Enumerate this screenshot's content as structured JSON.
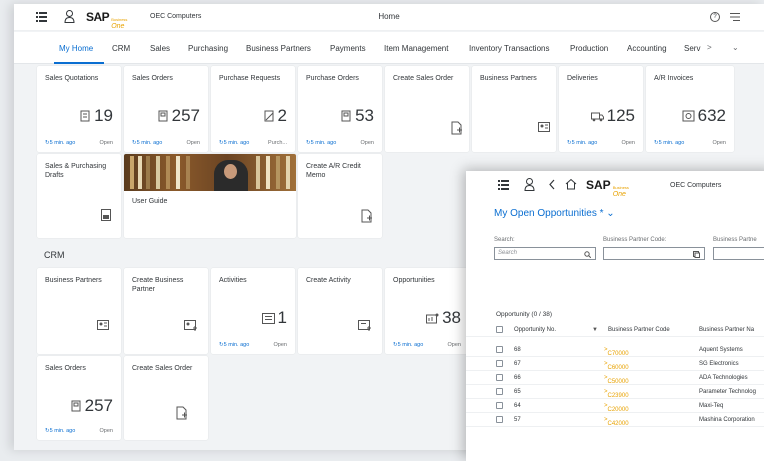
{
  "shell": {
    "brand": "SAP",
    "brand_sub_top": "Business",
    "brand_sub": "One",
    "company": "OEC Computers",
    "title": "Home",
    "help_icon": "help-icon",
    "more_icon": "overflow-icon"
  },
  "tabs": {
    "items": [
      "My Home",
      "CRM",
      "Sales",
      "Purchasing",
      "Business Partners",
      "Payments",
      "Item Management",
      "Inventory Transactions",
      "Production",
      "Accounting",
      "Serv"
    ],
    "active": "My Home"
  },
  "tiles_row1": [
    {
      "title": "Sales Quotations",
      "value": "19",
      "icon": "document-icon",
      "foot_l": "5 min. ago",
      "foot_r": "Open"
    },
    {
      "title": "Sales Orders",
      "value": "257",
      "icon": "sales-order-icon",
      "foot_l": "5 min. ago",
      "foot_r": "Open"
    },
    {
      "title": "Purchase Requests",
      "value": "2",
      "icon": "request-icon",
      "foot_l": "5 min. ago",
      "foot_r": "Purch..."
    },
    {
      "title": "Purchase Orders",
      "value": "53",
      "icon": "purchase-order-icon",
      "foot_l": "5 min. ago",
      "foot_r": "Open"
    },
    {
      "title": "Create Sales Order",
      "value": "",
      "icon": "add-document-icon",
      "foot_l": "",
      "foot_r": ""
    },
    {
      "title": "Business Partners",
      "value": "",
      "icon": "business-card-icon",
      "foot_l": "",
      "foot_r": ""
    },
    {
      "title": "Deliveries",
      "value": "125",
      "icon": "truck-icon",
      "foot_l": "5 min. ago",
      "foot_r": "Open"
    },
    {
      "title": "A/R Invoices",
      "value": "632",
      "icon": "invoice-icon",
      "foot_l": "5 min. ago",
      "foot_r": "Open"
    }
  ],
  "tiles_row2": [
    {
      "title": "Sales & Purchasing Drafts",
      "icon": "draft-icon"
    },
    {
      "title": "User Guide",
      "icon": "user-guide-image"
    },
    {
      "title": "Create A/R Credit Memo",
      "icon": "add-document-icon"
    }
  ],
  "crm": {
    "heading": "CRM",
    "tiles": [
      {
        "title": "Business Partners",
        "value": "",
        "icon": "business-card-icon",
        "foot_l": "",
        "foot_r": ""
      },
      {
        "title": "Create Business Partner",
        "value": "",
        "icon": "add-business-card-icon",
        "foot_l": "",
        "foot_r": ""
      },
      {
        "title": "Activities",
        "value": "1",
        "icon": "activity-icon",
        "foot_l": "5 min. ago",
        "foot_r": "Open"
      },
      {
        "title": "Create Activity",
        "value": "",
        "icon": "add-activity-icon",
        "foot_l": "",
        "foot_r": ""
      },
      {
        "title": "Opportunities",
        "value": "38",
        "icon": "opportunity-icon",
        "foot_l": "5 min. ago",
        "foot_r": "Open"
      }
    ],
    "tiles2": [
      {
        "title": "Sales Orders",
        "value": "257",
        "icon": "sales-order-icon",
        "foot_l": "5 min. ago",
        "foot_r": "Open"
      },
      {
        "title": "Create Sales Order",
        "value": "",
        "icon": "add-document-icon",
        "foot_l": "",
        "foot_r": ""
      }
    ]
  },
  "panel": {
    "company": "OEC Computers",
    "title": "My Open Opportunities *",
    "search_label": "Search:",
    "search_placeholder": "Search",
    "bp_code_label": "Business Partner Code:",
    "bp_name_label": "Business Partne",
    "grid_title": "Opportunity (0 / 38)",
    "columns": [
      "Opportunity No.",
      "Business Partner Code",
      "Business Partner Na"
    ],
    "rows": [
      {
        "no": "68",
        "code": "C70000",
        "name": "Aquent Systems"
      },
      {
        "no": "67",
        "code": "C60000",
        "name": "SG Electronics"
      },
      {
        "no": "66",
        "code": "C50000",
        "name": "ADA Technologies"
      },
      {
        "no": "65",
        "code": "C23900",
        "name": "Parameter Technolog"
      },
      {
        "no": "64",
        "code": "C20000",
        "name": "Maxi-Teq"
      },
      {
        "no": "57",
        "code": "C42000",
        "name": "Mashina Corporation"
      }
    ]
  }
}
